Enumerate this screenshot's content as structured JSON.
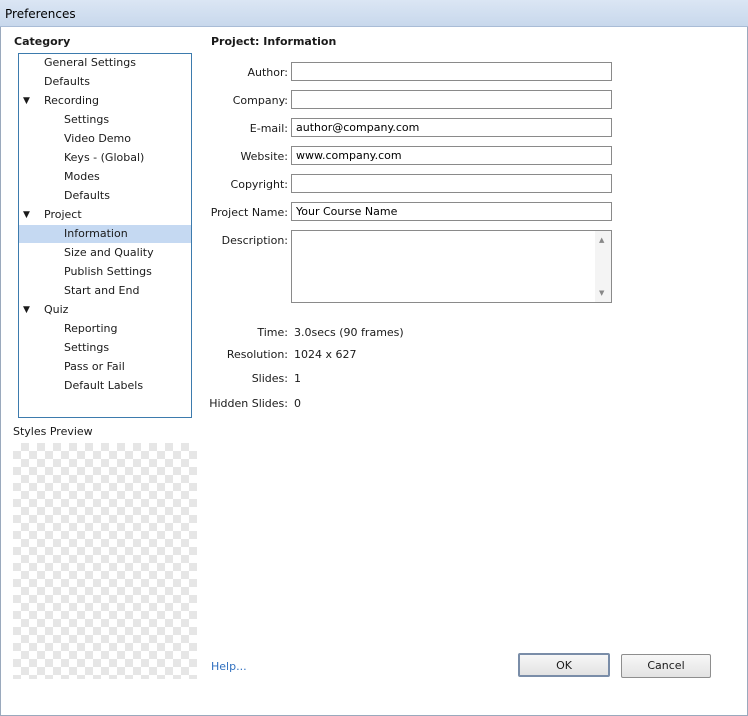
{
  "window": {
    "title": "Preferences"
  },
  "category": {
    "heading": "Category",
    "items": [
      {
        "label": "General Settings",
        "level": 0,
        "expandable": false,
        "selected": false
      },
      {
        "label": "Defaults",
        "level": 0,
        "expandable": false,
        "selected": false
      },
      {
        "label": "Recording",
        "level": 0,
        "expandable": true,
        "selected": false
      },
      {
        "label": "Settings",
        "level": 1,
        "expandable": false,
        "selected": false
      },
      {
        "label": "Video Demo",
        "level": 1,
        "expandable": false,
        "selected": false
      },
      {
        "label": "Keys - (Global)",
        "level": 1,
        "expandable": false,
        "selected": false
      },
      {
        "label": "Modes",
        "level": 1,
        "expandable": false,
        "selected": false
      },
      {
        "label": "Defaults",
        "level": 1,
        "expandable": false,
        "selected": false
      },
      {
        "label": "Project",
        "level": 0,
        "expandable": true,
        "selected": false
      },
      {
        "label": "Information",
        "level": 1,
        "expandable": false,
        "selected": true
      },
      {
        "label": "Size and Quality",
        "level": 1,
        "expandable": false,
        "selected": false
      },
      {
        "label": "Publish Settings",
        "level": 1,
        "expandable": false,
        "selected": false
      },
      {
        "label": "Start and End",
        "level": 1,
        "expandable": false,
        "selected": false
      },
      {
        "label": "Quiz",
        "level": 0,
        "expandable": true,
        "selected": false
      },
      {
        "label": "Reporting",
        "level": 1,
        "expandable": false,
        "selected": false
      },
      {
        "label": "Settings",
        "level": 1,
        "expandable": false,
        "selected": false
      },
      {
        "label": "Pass or Fail",
        "level": 1,
        "expandable": false,
        "selected": false
      },
      {
        "label": "Default Labels",
        "level": 1,
        "expandable": false,
        "selected": false
      }
    ],
    "expand_glyph": "▼"
  },
  "styles_preview": {
    "label": "Styles Preview"
  },
  "section": {
    "heading": "Project: Information"
  },
  "fields": {
    "author": {
      "label": "Author:",
      "value": ""
    },
    "company": {
      "label": "Company:",
      "value": ""
    },
    "email": {
      "label": "E-mail:",
      "value": "author@company.com"
    },
    "website": {
      "label": "Website:",
      "value": "www.company.com"
    },
    "copyright": {
      "label": "Copyright:",
      "value": ""
    },
    "project_name": {
      "label": "Project Name:",
      "value": "Your Course Name"
    },
    "description": {
      "label": "Description:",
      "value": ""
    }
  },
  "info": {
    "time": {
      "label": "Time:",
      "value": "3.0secs (90 frames)"
    },
    "resolution": {
      "label": "Resolution:",
      "value": "1024 x 627"
    },
    "slides": {
      "label": "Slides:",
      "value": "1"
    },
    "hidden_slides": {
      "label": "Hidden Slides:",
      "value": "0"
    }
  },
  "footer": {
    "help": "Help...",
    "ok": "OK",
    "cancel": "Cancel"
  },
  "colors": {
    "accent": "#3d7bad",
    "selection": "#c5d9f2",
    "link": "#2f6fbf"
  },
  "icons": {
    "scroll_up": "scroll-up-arrow-icon",
    "scroll_down": "scroll-down-arrow-icon",
    "expand": "expand-triangle-icon"
  }
}
